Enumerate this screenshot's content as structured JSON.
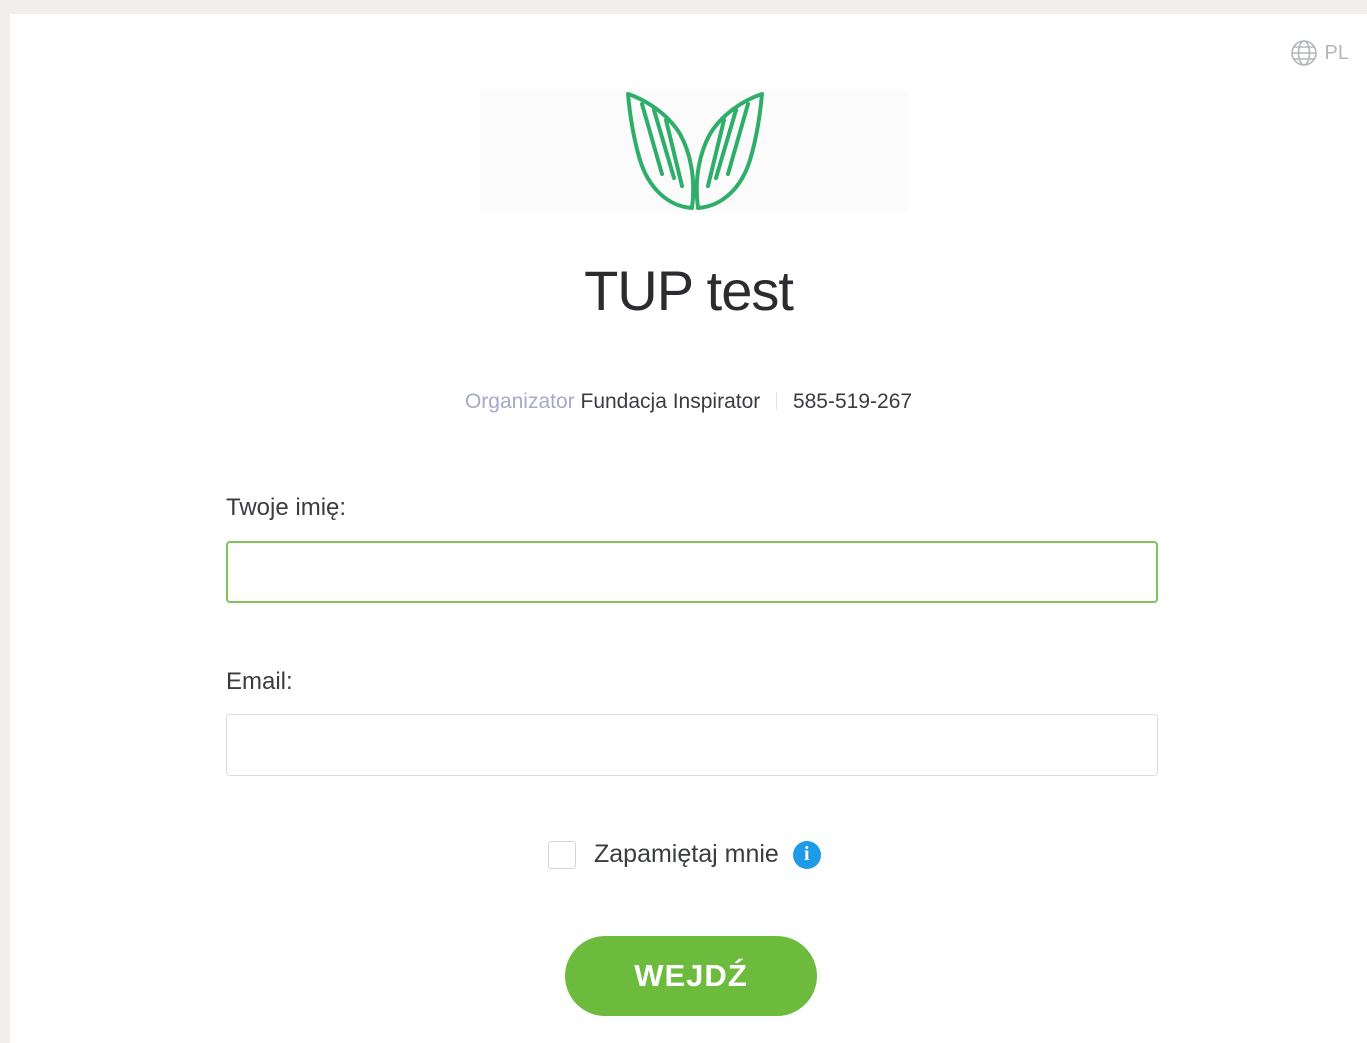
{
  "language": {
    "code": "PL",
    "icon": "globe-icon"
  },
  "logo": {
    "icon": "leaf-hands-logo",
    "color": "#2fae6a"
  },
  "event": {
    "title": "TUP test"
  },
  "organizer": {
    "label": "Organizator",
    "name": "Fundacja Inspirator",
    "phone": "585-519-267"
  },
  "form": {
    "name_label": "Twoje imię:",
    "name_value": "",
    "email_label": "Email:",
    "email_value": "",
    "remember_label": "Zapamiętaj mnie",
    "remember_checked": false,
    "info_icon": "info-icon",
    "submit_label": "WEJDŹ"
  },
  "colors": {
    "accent": "#6dbb3d",
    "focus_border": "#7cc35a",
    "info": "#1d9be6"
  }
}
